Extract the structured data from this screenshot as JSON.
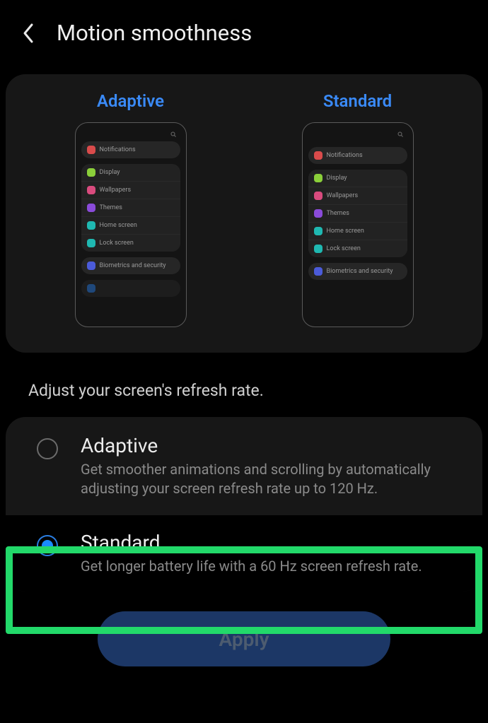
{
  "header": {
    "title": "Motion smoothness"
  },
  "preview": {
    "adaptive_label": "Adaptive",
    "standard_label": "Standard",
    "items": {
      "notifications": "Notifications",
      "display": "Display",
      "wallpapers": "Wallpapers",
      "themes": "Themes",
      "home_screen": "Home screen",
      "lock_screen": "Lock screen",
      "biometrics": "Biometrics and security"
    },
    "icon_colors": {
      "notifications": "#d94b4b",
      "display": "#8bcf3a",
      "wallpapers": "#d94b7e",
      "themes": "#8a4bd9",
      "home_screen": "#1fb8b1",
      "lock_screen": "#1fb8b1",
      "biometrics": "#4b5bd9"
    }
  },
  "section_label": "Adjust your screen's refresh rate.",
  "options": [
    {
      "key": "adaptive",
      "title": "Adaptive",
      "desc": "Get smoother animations and scrolling by automatically adjusting your screen refresh rate up to 120 Hz.",
      "selected": false
    },
    {
      "key": "standard",
      "title": "Standard",
      "desc": "Get longer battery life with a 60 Hz screen refresh rate.",
      "selected": true
    }
  ],
  "apply_label": "Apply"
}
